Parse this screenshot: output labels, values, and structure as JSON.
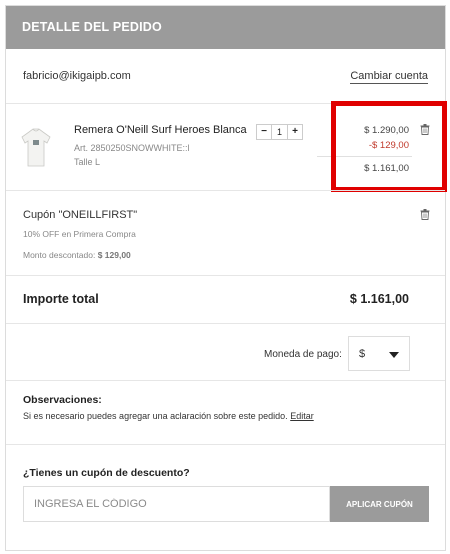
{
  "header": {
    "title": "DETALLE DEL PEDIDO"
  },
  "account": {
    "email": "fabricio@ikigaipb.com",
    "change_label": "Cambiar cuenta"
  },
  "product": {
    "name": "Remera O'Neill Surf Heroes Blanca",
    "article": "Art. 2850250SNOWWHITE::l",
    "size": "Talle L",
    "quantity": "1",
    "decrement_label": "−",
    "increment_label": "+",
    "price_original": "$ 1.290,00",
    "price_discount": "-$ 129,00",
    "price_final": "$ 1.161,00",
    "image_icon": "t-shirt-icon",
    "delete_icon": "trash-icon"
  },
  "coupon": {
    "title": "Cupón \"ONEILLFIRST\"",
    "description": "10% OFF en Primera Compra",
    "amount_label": "Monto descontado:",
    "amount_value": "$ 129,00",
    "delete_icon": "trash-icon"
  },
  "total": {
    "label": "Importe total",
    "value": "$ 1.161,00"
  },
  "currency": {
    "label": "Moneda de pago:",
    "value": "$"
  },
  "observations": {
    "title": "Observaciones:",
    "text": "Si es necesario puedes agregar una aclaración sobre este pedido.",
    "edit_label": "Editar"
  },
  "discount_code": {
    "question": "¿Tienes un cupón de descuento?",
    "placeholder": "INGRESA EL CÓDIGO",
    "button_label": "APLICAR CUPÓN"
  },
  "colors": {
    "header_bg": "#9b9b9b",
    "discount": "#c0392b",
    "highlight": "#e00000"
  }
}
